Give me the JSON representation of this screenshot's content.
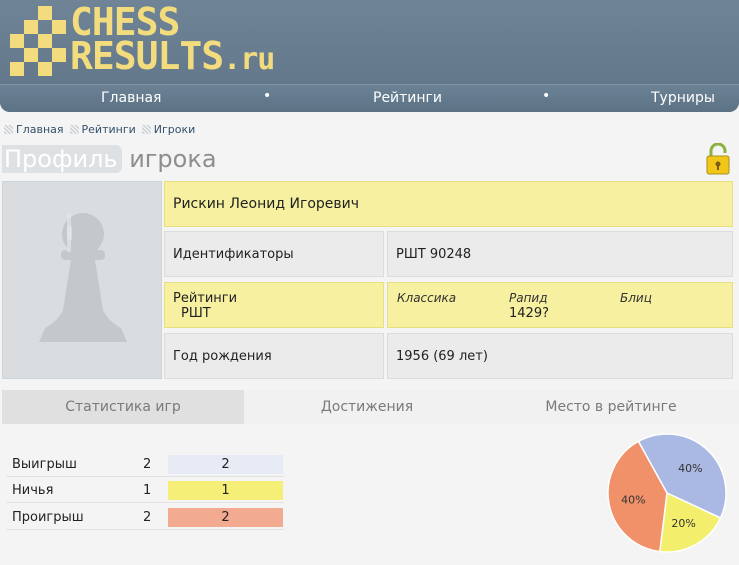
{
  "logo": {
    "line1": "CHESS",
    "line2_main": "RESULTS",
    "line2_suffix": ".ru"
  },
  "nav": {
    "items": [
      "Главная",
      "Рейтинги",
      "Турниры"
    ],
    "separator": "•"
  },
  "breadcrumb": [
    "Главная",
    "Рейтинги",
    "Игроки"
  ],
  "page_title": {
    "highlight": "Профиль",
    "rest": " игрока"
  },
  "player": {
    "name": "Рискин Леонид Игоревич",
    "ids_label": "Идентификаторы",
    "ids_value": "РШТ 90248",
    "ratings_label": "Рейтинги",
    "ratings_sub": "РШТ",
    "rating_headers": [
      "Классика",
      "Рапид",
      "Блиц"
    ],
    "rapid_value": "1429?",
    "birth_label": "Год рождения",
    "birth_value": "1956 (69 лет)"
  },
  "tabs": [
    "Статистика игр",
    "Достижения",
    "Место в рейтинге"
  ],
  "stats": [
    {
      "label": "Выигрыш",
      "count": "2",
      "bar": "2",
      "color": "#e6ebf5"
    },
    {
      "label": "Ничья",
      "count": "1",
      "bar": "1",
      "color": "#f5ef78"
    },
    {
      "label": "Проигрыш",
      "count": "2",
      "bar": "2",
      "color": "#f2ab90"
    }
  ],
  "chart_data": {
    "type": "pie",
    "labels": [
      "Выигрыш",
      "Ничья",
      "Проигрыш"
    ],
    "values": [
      40,
      20,
      40
    ],
    "display": [
      "40%",
      "20%",
      "40%"
    ],
    "colors": [
      "#aab9e3",
      "#f3ee6c",
      "#f0916a"
    ]
  },
  "colors": {
    "header": "#6a8093",
    "logo_text": "#f3dc7e",
    "yellow_cell": "#f6f0a0",
    "grey_cell": "#ebebeb"
  }
}
